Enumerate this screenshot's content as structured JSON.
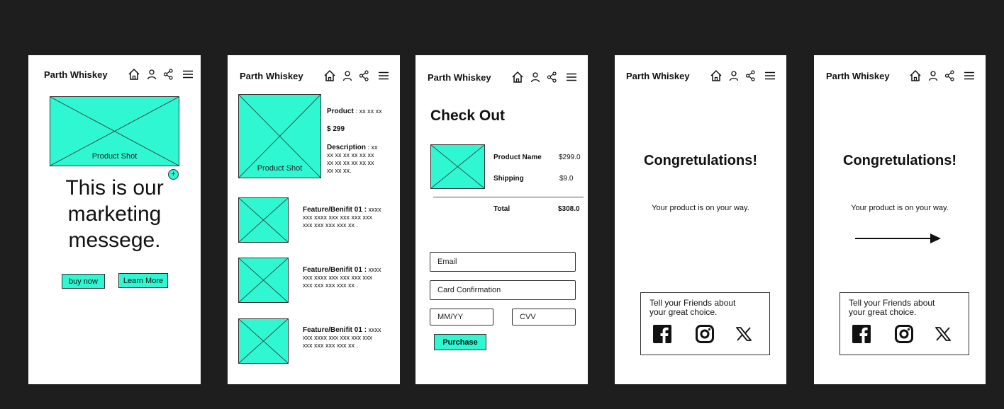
{
  "brand": "Parth Whiskey",
  "accent_color": "#2ff7d2",
  "header_icons": [
    "home-icon",
    "user-icon",
    "share-icon",
    "menu-icon"
  ],
  "screen1": {
    "product_shot_label": "Product Shot",
    "marketing_message": [
      "This is our",
      "marketing",
      "messege."
    ],
    "buy_now": "buy now",
    "learn_more": "Learn More"
  },
  "screen2": {
    "product_shot_label": "Product Shot",
    "product_label": "Product",
    "product_value": ": xx xx xx",
    "price": "$ 299",
    "description_label": "Description",
    "description_lines": [
      ": xx",
      "xx xx xx xx xx xx",
      "xx xx xx xx xx xx",
      "xx xx xx."
    ],
    "features": [
      {
        "label": "Feature/Benifit 01 :",
        "lines": [
          "xxxx",
          "xxx xxxx xxx xxx xxx xxx",
          "xxx xxx xxx xxx xx ."
        ]
      },
      {
        "label": "Feature/Benifit 01 :",
        "lines": [
          "xxxx",
          "xxx xxxx xxx xxx xxx xxx",
          "xxx xxx xxx xxx xx ."
        ]
      },
      {
        "label": "Feature/Benifit 01 :",
        "lines": [
          "xxxx",
          "xxx xxxx xxx xxx xxx xxx",
          "xxx xxx xxx xxx xx ."
        ]
      }
    ]
  },
  "screen3": {
    "title": "Check Out",
    "product_name_label": "Product Name",
    "product_name_value": "$299.0",
    "shipping_label": "Shipping",
    "shipping_value": "$9.0",
    "total_label": "Total",
    "total_value": "$308.0",
    "email_placeholder": "Email",
    "card_placeholder": "Card Confirmation",
    "mmyy_placeholder": "MM/YY",
    "cvv_placeholder": "CVV",
    "purchase": "Purchase"
  },
  "screen4": {
    "title": "Congretulations!",
    "subtitle": "Your product is on your way.",
    "share_line1": "Tell your Friends about",
    "share_line2": "your great choice.",
    "social_icons": [
      "facebook-icon",
      "instagram-icon",
      "x-icon"
    ]
  },
  "screen5": {
    "title": "Congretulations!",
    "subtitle": "Your product is on your way.",
    "share_line1": "Tell your Friends about",
    "share_line2": "your great choice.",
    "social_icons": [
      "facebook-icon",
      "instagram-icon",
      "x-icon"
    ]
  }
}
